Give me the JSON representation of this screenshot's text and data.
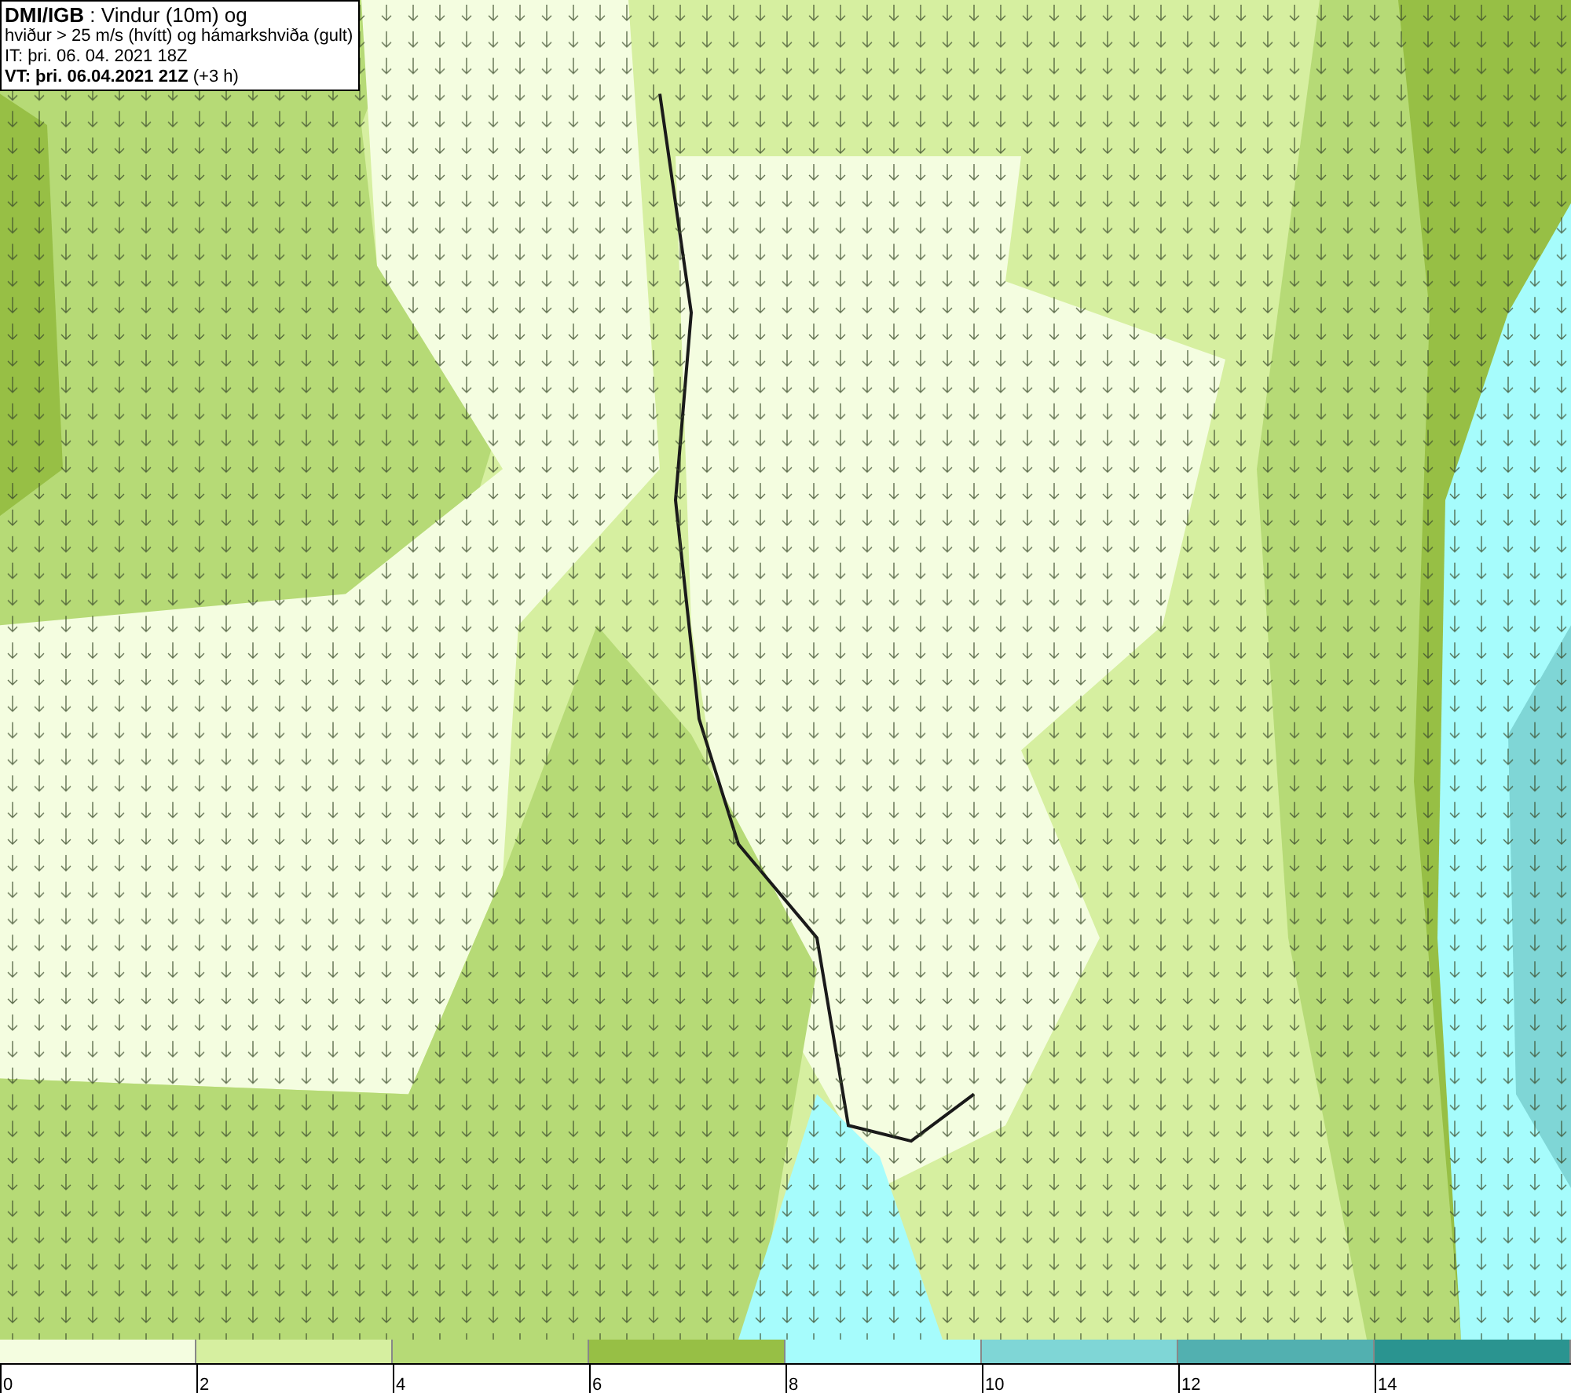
{
  "title_box": {
    "lines": [
      "**DMI/IGB** : Vindur (10m) og",
      "hviður > 25 m/s (hvítt) og hámarkshviða (gult)",
      "IT: þri. 06. 04. 2021 18Z",
      "**VT: þri. 06.04.2021 21Z** (+3 h)"
    ]
  },
  "legend": {
    "bins": [
      {
        "label": "0",
        "color": "#f4fde0"
      },
      {
        "label": "2",
        "color": "#d6efa0"
      },
      {
        "label": "4",
        "color": "#b6da76"
      },
      {
        "label": "6",
        "color": "#97bf45"
      },
      {
        "label": "8",
        "color": "#a6fcfc"
      },
      {
        "label": "10",
        "color": "#7fd6d6"
      },
      {
        "label": "12",
        "color": "#52b0b0"
      },
      {
        "label": "14",
        "color": "#2a9490"
      }
    ]
  }
}
